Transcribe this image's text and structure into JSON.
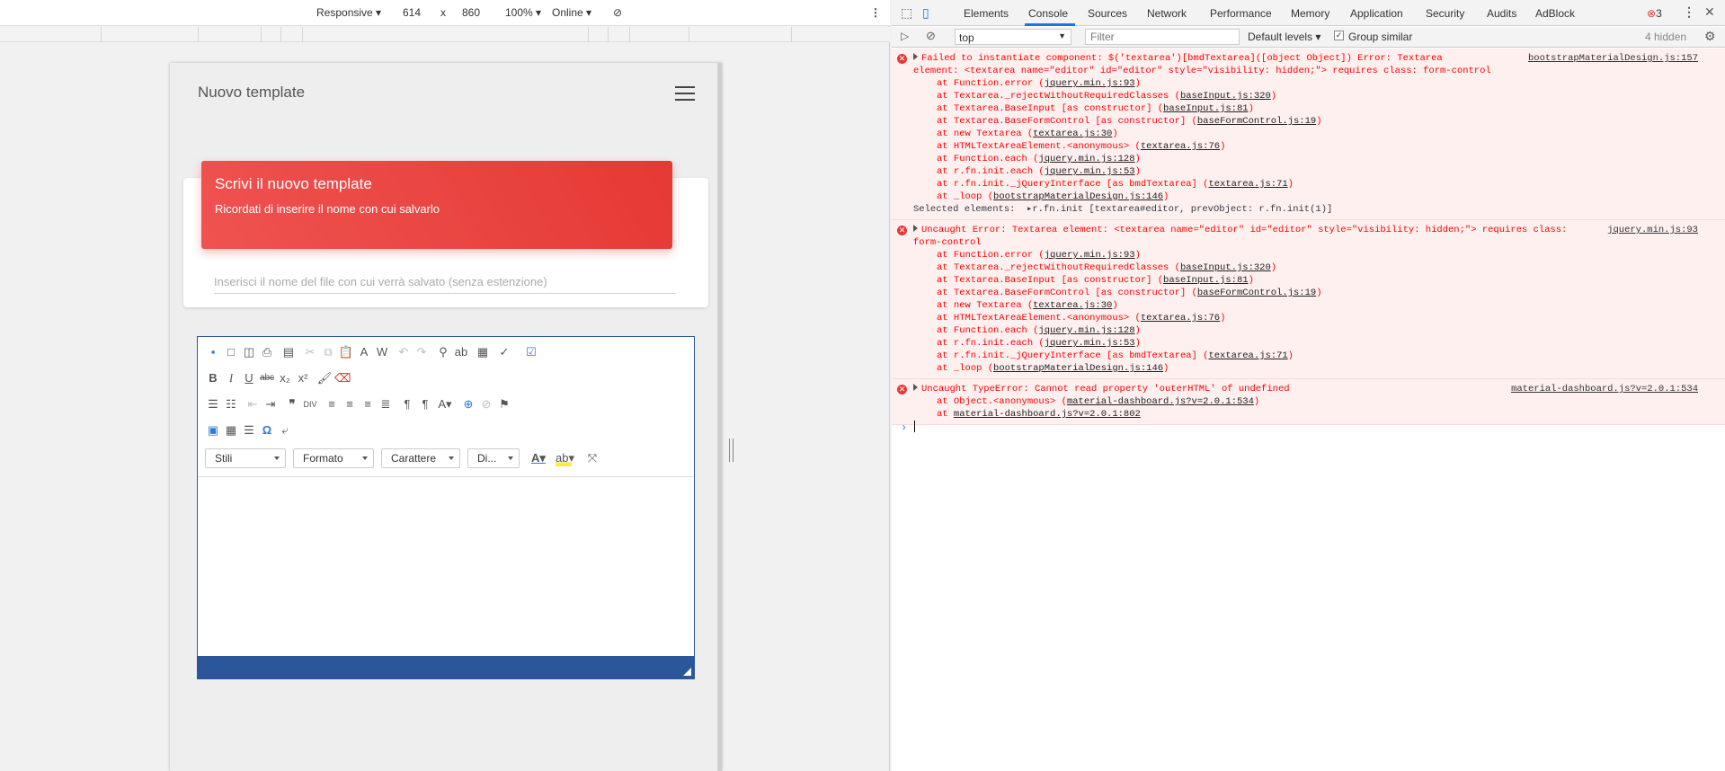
{
  "device_toolbar": {
    "device": "Responsive",
    "width": "614",
    "times": "x",
    "height": "860",
    "zoom": "100%",
    "network": "Online"
  },
  "app": {
    "title": "Nuovo template",
    "card_title": "Scrivi il nuovo template",
    "card_subtitle": "Ricordati di inserire il nome con cui salvarlo",
    "filename_placeholder": "Inserisci il nome del file con cui verrà salvato (senza estenzione)",
    "combos": [
      "Stili",
      "Formato",
      "Carattere",
      "Di..."
    ]
  },
  "devtools": {
    "tabs": [
      "Elements",
      "Console",
      "Sources",
      "Network",
      "Performance",
      "Memory",
      "Application",
      "Security",
      "Audits",
      "AdBlock"
    ],
    "error_count": "3",
    "context": "top",
    "filter_placeholder": "Filter",
    "levels": "Default levels",
    "group_similar": "Group similar",
    "hidden": "4 hidden"
  },
  "messages": [
    {
      "source": "bootstrapMaterialDesign.js:157",
      "lines": [
        "Failed to instantiate component: $('textarea')[bmdTextarea]([object Object]) Error: Textarea",
        "element: <textarea name=\"editor\" id=\"editor\" style=\"visibility: hidden;\"> requires class: form-control"
      ],
      "stack": [
        [
          "at Function.error (",
          "jquery.min.js:93",
          ")"
        ],
        [
          "at Textarea._rejectWithoutRequiredClasses (",
          "baseInput.js:320",
          ")"
        ],
        [
          "at Textarea.BaseInput [as constructor] (",
          "baseInput.js:81",
          ")"
        ],
        [
          "at Textarea.BaseFormControl [as constructor] (",
          "baseFormControl.js:19",
          ")"
        ],
        [
          "at new Textarea (",
          "textarea.js:30",
          ")"
        ],
        [
          "at HTMLTextAreaElement.<anonymous> (",
          "textarea.js:76",
          ")"
        ],
        [
          "at Function.each (",
          "jquery.min.js:128",
          ")"
        ],
        [
          "at r.fn.init.each (",
          "jquery.min.js:53",
          ")"
        ],
        [
          "at r.fn.init._jQueryInterface [as bmdTextarea] (",
          "textarea.js:71",
          ")"
        ],
        [
          "at _loop (",
          "bootstrapMaterialDesign.js:146",
          ")"
        ]
      ],
      "selected": "Selected elements:  ▸r.fn.init [textarea#editor, prevObject: r.fn.init(1)]"
    },
    {
      "source": "jquery.min.js:93",
      "lines": [
        "Uncaught Error: Textarea element: <textarea name=\"editor\" id=\"editor\" style=\"visibility: hidden;\"> requires class:",
        "form-control"
      ],
      "stack": [
        [
          "at Function.error (",
          "jquery.min.js:93",
          ")"
        ],
        [
          "at Textarea._rejectWithoutRequiredClasses (",
          "baseInput.js:320",
          ")"
        ],
        [
          "at Textarea.BaseInput [as constructor] (",
          "baseInput.js:81",
          ")"
        ],
        [
          "at Textarea.BaseFormControl [as constructor] (",
          "baseFormControl.js:19",
          ")"
        ],
        [
          "at new Textarea (",
          "textarea.js:30",
          ")"
        ],
        [
          "at HTMLTextAreaElement.<anonymous> (",
          "textarea.js:76",
          ")"
        ],
        [
          "at Function.each (",
          "jquery.min.js:128",
          ")"
        ],
        [
          "at r.fn.init.each (",
          "jquery.min.js:53",
          ")"
        ],
        [
          "at r.fn.init._jQueryInterface [as bmdTextarea] (",
          "textarea.js:71",
          ")"
        ],
        [
          "at _loop (",
          "bootstrapMaterialDesign.js:146",
          ")"
        ]
      ],
      "selected": ""
    },
    {
      "source": "material-dashboard.js?v=2.0.1:534",
      "lines": [
        "Uncaught TypeError: Cannot read property 'outerHTML' of undefined"
      ],
      "stack": [
        [
          "at Object.<anonymous> (",
          "material-dashboard.js?v=2.0.1:534",
          ")"
        ],
        [
          "at ",
          "material-dashboard.js?v=2.0.1:802",
          ""
        ]
      ],
      "selected": ""
    }
  ],
  "prompt": "›"
}
